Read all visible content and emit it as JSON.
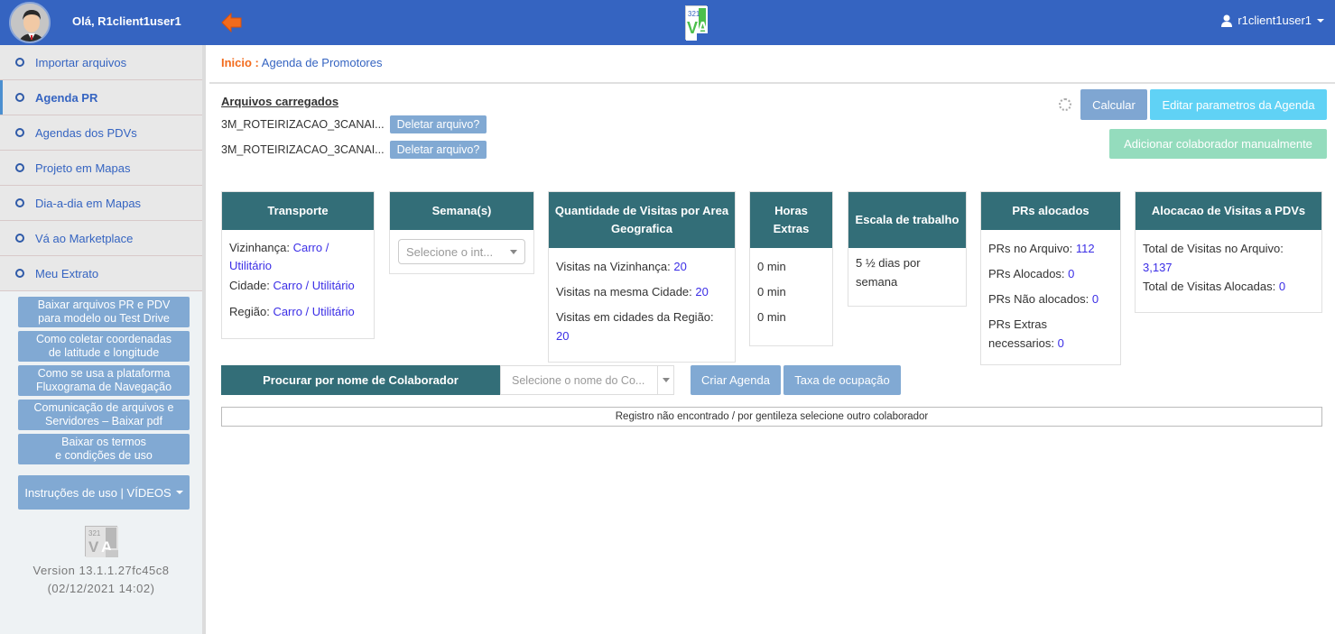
{
  "header": {
    "greeting": "Olá, R1client1user1",
    "user_menu_label": "r1client1user1",
    "logo_text_top": "321",
    "logo_text_bottom": "VA"
  },
  "sidebar": {
    "nav": [
      {
        "label": "Importar arquivos",
        "active": false
      },
      {
        "label": "Agenda PR",
        "active": true
      },
      {
        "label": "Agendas dos PDVs",
        "active": false
      },
      {
        "label": "Projeto em Mapas",
        "active": false
      },
      {
        "label": "Dia-a-dia em Mapas",
        "active": false
      },
      {
        "label": "Vá ao Marketplace",
        "active": false
      },
      {
        "label": "Meu Extrato",
        "active": false
      }
    ],
    "buttons": [
      {
        "line1": "Baixar arquivos PR e PDV",
        "line2": "para modelo ou Test Drive"
      },
      {
        "line1": "Como coletar coordenadas",
        "line2": "de latitude e longitude"
      },
      {
        "line1": "Como se usa a plataforma",
        "line2": "Fluxograma de Navegação"
      },
      {
        "line1": "Comunicação de arquivos e",
        "line2": "Servidores – Baixar pdf"
      },
      {
        "line1": "Baixar os termos",
        "line2": "e condições de uso"
      }
    ],
    "videos_label": "Instruções de uso | VÍDEOS",
    "version": "Version 13.1.1.27fc45c8",
    "version_date": "(02/12/2021 14:02)"
  },
  "breadcrumb": {
    "home": "Inicio :",
    "current": "Agenda de Promotores"
  },
  "files": {
    "title": "Arquivos carregados",
    "items": [
      {
        "name": "3M_ROTEIRIZACAO_3CANAI...",
        "delete_label": "Deletar arquivo?"
      },
      {
        "name": "3M_ROTEIRIZACAO_3CANAI...",
        "delete_label": "Deletar arquivo?"
      }
    ]
  },
  "actions": {
    "calcular": "Calcular",
    "editar": "Editar parametros da Agenda",
    "adicionar": "Adicionar colaborador manualmente"
  },
  "cards": {
    "transporte": {
      "title": "Transporte",
      "vizinhanca_label": "Vizinhança:",
      "vizinhanca_value": "Carro / Utilitário",
      "cidade_label": "Cidade:",
      "cidade_value": "Carro / Utilitário",
      "regiao_label": "Região:",
      "regiao_value": "Carro / Utilitário"
    },
    "semanas": {
      "title": "Semana(s)",
      "placeholder": "Selecione o int..."
    },
    "visitas": {
      "title": "Quantidade de Visitas por Area Geografica",
      "vizinhanca_label": "Visitas na Vizinhança:",
      "vizinhanca_value": "20",
      "cidade_label": "Visitas na mesma Cidade:",
      "cidade_value": "20",
      "regiao_label": "Visitas em cidades da Região:",
      "regiao_value": "20"
    },
    "horas": {
      "title": "Horas Extras",
      "values": [
        "0 min",
        "0 min",
        "0 min"
      ]
    },
    "escala": {
      "title": "Escala de trabalho",
      "value": "5 ½ dias por semana"
    },
    "prs": {
      "title": "PRs alocados",
      "arquivo_label": "PRs no Arquivo:",
      "arquivo_value": "112",
      "alocados_label": "PRs Alocados:",
      "alocados_value": "0",
      "nao_label": "PRs Não alocados:",
      "nao_value": "0",
      "extras_label": "PRs Extras necessarios:",
      "extras_value": "0"
    },
    "alocacao": {
      "title": "Alocacao de Visitas a PDVs",
      "total_label": "Total de Visitas no Arquivo:",
      "total_value": "3,137",
      "alocadas_label": "Total de Visitas Alocadas:",
      "alocadas_value": "0"
    }
  },
  "search": {
    "label": "Procurar por nome de Colaborador",
    "placeholder": "Selecione o nome do Co...",
    "criar": "Criar Agenda",
    "taxa": "Taxa de ocupação"
  },
  "message": "Registro não encontrado / por gentileza selecione outro colaborador"
}
